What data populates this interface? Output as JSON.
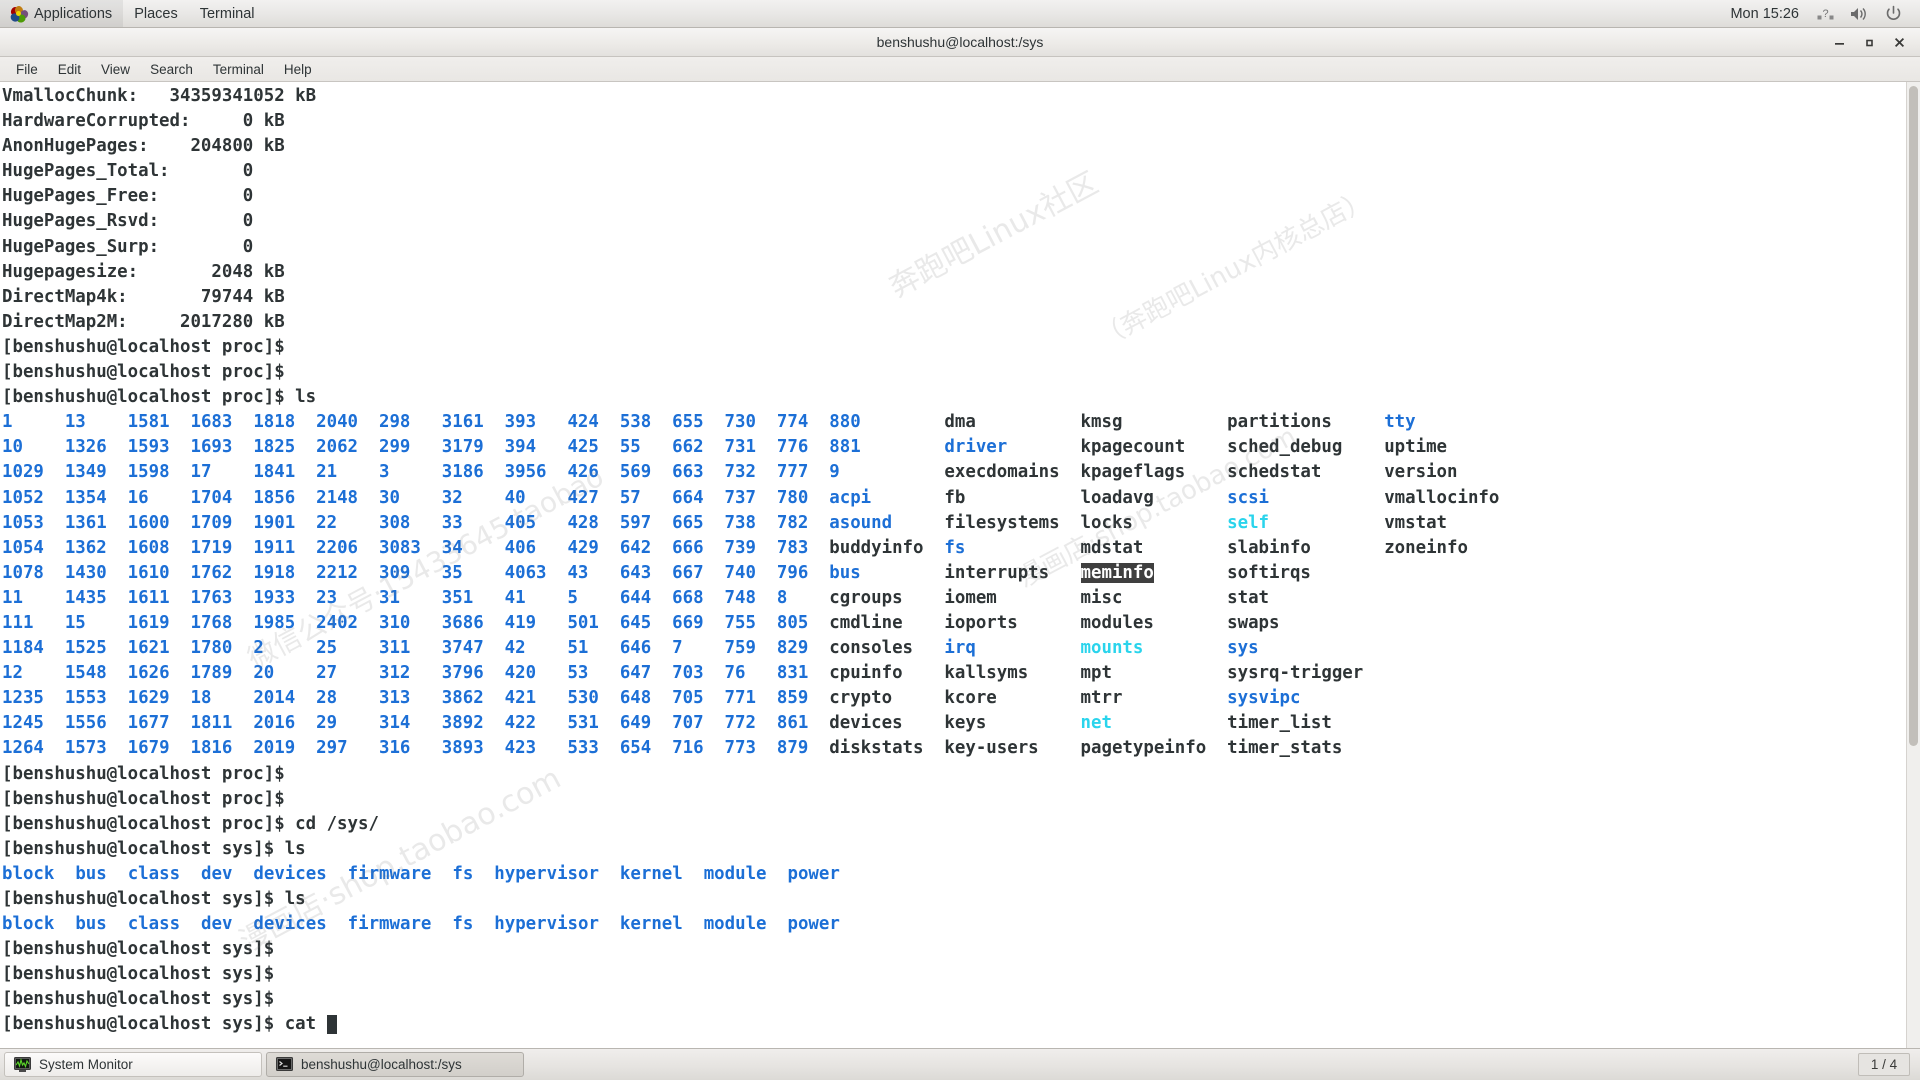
{
  "desktop": {
    "panel": {
      "menus": [
        {
          "label": "Applications",
          "icon": "gnome-foot-icon"
        },
        {
          "label": "Places",
          "icon": null
        },
        {
          "label": "Terminal",
          "icon": null
        }
      ],
      "clock": "Mon 15:26",
      "tray": [
        "keyboard-indicator-icon",
        "volume-icon",
        "power-icon"
      ]
    },
    "taskbar": {
      "tasks": [
        {
          "label": "System Monitor",
          "icon": "system-monitor-icon",
          "active": false
        },
        {
          "label": "benshushu@localhost:/sys",
          "icon": "terminal-icon",
          "active": true
        }
      ],
      "workspace": "1 / 4"
    }
  },
  "window": {
    "title": "benshushu@localhost:/sys",
    "controls": {
      "minimize": "–",
      "maximize": "□",
      "close": "✕"
    },
    "menubar": [
      "File",
      "Edit",
      "View",
      "Search",
      "Terminal",
      "Help"
    ]
  },
  "terminal": {
    "prompt_proc": "[benshushu@localhost proc]$",
    "prompt_sys": "[benshushu@localhost sys]$",
    "meminfo_tail": [
      {
        "key": "VmallocChunk:",
        "value": "34359341052 kB"
      },
      {
        "key": "HardwareCorrupted:",
        "value": "0 kB"
      },
      {
        "key": "AnonHugePages:",
        "value": "204800 kB"
      },
      {
        "key": "HugePages_Total:",
        "value": "0"
      },
      {
        "key": "HugePages_Free:",
        "value": "0"
      },
      {
        "key": "HugePages_Rsvd:",
        "value": "0"
      },
      {
        "key": "HugePages_Surp:",
        "value": "0"
      },
      {
        "key": "Hugepagesize:",
        "value": "2048 kB"
      },
      {
        "key": "DirectMap4k:",
        "value": "79744 kB"
      },
      {
        "key": "DirectMap2M:",
        "value": "2017280 kB"
      }
    ],
    "meminfo_lines": [
      "VmallocChunk:   34359341052 kB",
      "HardwareCorrupted:     0 kB",
      "AnonHugePages:    204800 kB",
      "HugePages_Total:       0",
      "HugePages_Free:        0",
      "HugePages_Rsvd:        0",
      "HugePages_Surp:        0",
      "Hugepagesize:       2048 kB",
      "DirectMap4k:       79744 kB",
      "DirectMap2M:     2017280 kB"
    ],
    "commands": {
      "ls": "ls",
      "cd_sys": "cd /sys/",
      "cat": "cat"
    },
    "proc_ls": {
      "columns": [
        [
          "1",
          "10",
          "1029",
          "1052",
          "1053",
          "1054",
          "1078",
          "11",
          "111",
          "1184",
          "12",
          "1235",
          "1245",
          "1264"
        ],
        [
          "13",
          "1326",
          "1349",
          "1354",
          "1361",
          "1362",
          "1430",
          "1435",
          "15",
          "1525",
          "1548",
          "1553",
          "1556",
          "1573"
        ],
        [
          "1581",
          "1593",
          "1598",
          "16",
          "1600",
          "1608",
          "1610",
          "1611",
          "1619",
          "1621",
          "1626",
          "1629",
          "1677",
          "1679"
        ],
        [
          "1683",
          "1693",
          "17",
          "1704",
          "1709",
          "1719",
          "1762",
          "1763",
          "1768",
          "1780",
          "1789",
          "18",
          "1811",
          "1816"
        ],
        [
          "1818",
          "1825",
          "1841",
          "1856",
          "1901",
          "1911",
          "1918",
          "1933",
          "1985",
          "2",
          "20",
          "2014",
          "2016",
          "2019"
        ],
        [
          "2040",
          "2062",
          "21",
          "2148",
          "22",
          "2206",
          "2212",
          "23",
          "2402",
          "25",
          "27",
          "28",
          "29",
          "297"
        ],
        [
          "298",
          "299",
          "3",
          "30",
          "308",
          "3083",
          "309",
          "31",
          "310",
          "311",
          "312",
          "313",
          "314",
          "316"
        ],
        [
          "3161",
          "3179",
          "3186",
          "32",
          "33",
          "34",
          "35",
          "351",
          "3686",
          "3747",
          "3796",
          "3862",
          "3892",
          "3893"
        ],
        [
          "393",
          "394",
          "3956",
          "40",
          "405",
          "406",
          "4063",
          "41",
          "419",
          "42",
          "420",
          "421",
          "422",
          "423"
        ],
        [
          "424",
          "425",
          "426",
          "427",
          "428",
          "429",
          "43",
          "5",
          "501",
          "51",
          "53",
          "530",
          "531",
          "533"
        ],
        [
          "538",
          "55",
          "569",
          "57",
          "597",
          "642",
          "643",
          "644",
          "645",
          "646",
          "647",
          "648",
          "649",
          "654"
        ],
        [
          "655",
          "662",
          "663",
          "664",
          "665",
          "666",
          "667",
          "668",
          "669",
          "7",
          "703",
          "705",
          "707",
          "716"
        ],
        [
          "730",
          "731",
          "732",
          "737",
          "738",
          "739",
          "740",
          "748",
          "755",
          "759",
          "76",
          "771",
          "772",
          "773"
        ],
        [
          "774",
          "776",
          "777",
          "780",
          "782",
          "783",
          "796",
          "8",
          "805",
          "829",
          "831",
          "859",
          "861",
          "879"
        ],
        [
          "880",
          "881",
          "9",
          "acpi",
          "asound",
          "buddyinfo",
          "bus",
          "cgroups",
          "cmdline",
          "consoles",
          "cpuinfo",
          "crypto",
          "devices",
          "diskstats"
        ],
        [
          "dma",
          "driver",
          "execdomains",
          "fb",
          "filesystems",
          "fs",
          "interrupts",
          "iomem",
          "ioports",
          "irq",
          "kallsyms",
          "kcore",
          "keys",
          "key-users"
        ],
        [
          "kmsg",
          "kpagecount",
          "kpageflags",
          "loadavg",
          "locks",
          "mdstat",
          "meminfo",
          "misc",
          "modules",
          "mounts",
          "mpt",
          "mtrr",
          "net",
          "pagetypeinfo"
        ],
        [
          "partitions",
          "sched_debug",
          "schedstat",
          "scsi",
          "self",
          "slabinfo",
          "softirqs",
          "stat",
          "swaps",
          "sys",
          "sysrq-trigger",
          "sysvipc",
          "timer_list",
          "timer_stats"
        ],
        [
          "tty",
          "uptime",
          "version",
          "vmallocinfo",
          "vmstat",
          "zoneinfo"
        ]
      ],
      "directories": [
        "1",
        "10",
        "1029",
        "1052",
        "1053",
        "1054",
        "1078",
        "11",
        "111",
        "1184",
        "12",
        "1235",
        "1245",
        "1264",
        "13",
        "1326",
        "1349",
        "1354",
        "1361",
        "1362",
        "1430",
        "1435",
        "15",
        "1525",
        "1548",
        "1553",
        "1556",
        "1573",
        "1581",
        "1593",
        "1598",
        "16",
        "1600",
        "1608",
        "1610",
        "1611",
        "1619",
        "1621",
        "1626",
        "1629",
        "1677",
        "1679",
        "1683",
        "1693",
        "17",
        "1704",
        "1709",
        "1719",
        "1762",
        "1763",
        "1768",
        "1780",
        "1789",
        "18",
        "1811",
        "1816",
        "1818",
        "1825",
        "1841",
        "1856",
        "1901",
        "1911",
        "1918",
        "1933",
        "1985",
        "2",
        "20",
        "2014",
        "2016",
        "2019",
        "2040",
        "2062",
        "21",
        "2148",
        "22",
        "2206",
        "2212",
        "23",
        "2402",
        "25",
        "27",
        "28",
        "29",
        "297",
        "298",
        "299",
        "3",
        "30",
        "308",
        "3083",
        "309",
        "31",
        "310",
        "311",
        "312",
        "313",
        "314",
        "316",
        "3161",
        "3179",
        "3186",
        "32",
        "33",
        "34",
        "35",
        "351",
        "3686",
        "3747",
        "3796",
        "3862",
        "3892",
        "3893",
        "393",
        "394",
        "3956",
        "40",
        "405",
        "406",
        "4063",
        "41",
        "419",
        "42",
        "420",
        "421",
        "422",
        "423",
        "424",
        "425",
        "426",
        "427",
        "428",
        "429",
        "43",
        "5",
        "501",
        "51",
        "53",
        "530",
        "531",
        "533",
        "538",
        "55",
        "569",
        "57",
        "597",
        "642",
        "643",
        "644",
        "645",
        "646",
        "647",
        "648",
        "649",
        "654",
        "655",
        "662",
        "663",
        "664",
        "665",
        "666",
        "667",
        "668",
        "669",
        "7",
        "703",
        "705",
        "707",
        "716",
        "730",
        "731",
        "732",
        "737",
        "738",
        "739",
        "740",
        "748",
        "755",
        "759",
        "76",
        "771",
        "772",
        "773",
        "774",
        "776",
        "777",
        "780",
        "782",
        "783",
        "796",
        "8",
        "805",
        "829",
        "831",
        "859",
        "861",
        "879",
        "880",
        "881",
        "9",
        "acpi",
        "asound",
        "bus",
        "driver",
        "fs",
        "irq",
        "scsi",
        "sys",
        "sysvipc",
        "tty"
      ],
      "symlinks": [
        "mounts",
        "net",
        "self"
      ],
      "highlighted": "meminfo"
    },
    "sys_ls": [
      "block",
      "bus",
      "class",
      "dev",
      "devices",
      "firmware",
      "fs",
      "hypervisor",
      "kernel",
      "module",
      "power"
    ],
    "colors": {
      "directory": "#1c6fd6",
      "symlink": "#2ad4ec",
      "file": "#2e3436",
      "background": "#ffffff",
      "highlight_bg": "#3f3f3f",
      "highlight_fg": "#ffffff"
    }
  },
  "watermarks": [
    "奔跑吧Linux社区",
    "奔跑吧Linux内核总店",
    "漫画店·shop.taobao.com",
    "微信公众号·15433645·taobao"
  ]
}
